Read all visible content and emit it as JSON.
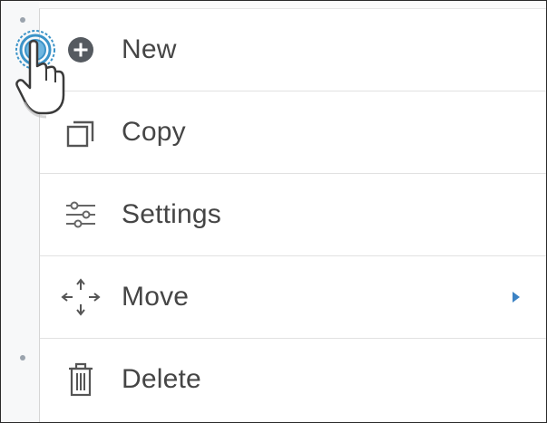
{
  "menu": {
    "items": [
      {
        "label": "New",
        "icon": "plus-circle-icon"
      },
      {
        "label": "Copy",
        "icon": "copy-icon"
      },
      {
        "label": "Settings",
        "icon": "sliders-icon"
      },
      {
        "label": "Move",
        "icon": "move-arrows-icon",
        "has_submenu": true
      },
      {
        "label": "Delete",
        "icon": "trash-icon"
      }
    ]
  },
  "colors": {
    "icon_dark": "#454545",
    "icon_gray": "#7a7a7a",
    "accent_arrow": "#3b82c4",
    "cursor_ring": "#3b93c8"
  }
}
